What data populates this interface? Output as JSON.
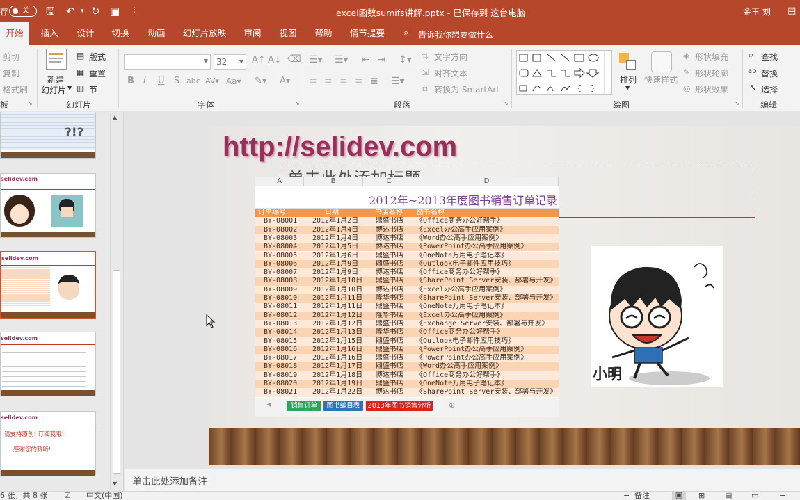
{
  "titlebar": {
    "autosave_label": "存",
    "autosave_state": "关",
    "title": "excel函数sumifs讲解.pptx  -  已保存到 这台电脑",
    "user": "金玉 刘"
  },
  "tabs": [
    "开始",
    "插入",
    "设计",
    "切换",
    "动画",
    "幻灯片放映",
    "审阅",
    "视图",
    "帮助",
    "情节提要"
  ],
  "tell_me": "告诉我你想要做什么",
  "ribbon": {
    "clipboard": {
      "cut": "剪切",
      "copy": "复制",
      "format": "格式刷",
      "label": "板"
    },
    "slides": {
      "new_slide": "新建",
      "new_slide2": "幻灯片",
      "layout": "版式",
      "reset": "重置",
      "section": "节",
      "label": "幻灯片"
    },
    "font": {
      "size": "32",
      "label": "字体"
    },
    "paragraph": {
      "text_direction": "文字方向",
      "align_text": "对齐文本",
      "smartart": "转换为 SmartArt",
      "label": "段落"
    },
    "drawing": {
      "arrange": "排列",
      "quick_styles": "快速样式",
      "shape_fill": "形状填充",
      "shape_outline": "形状轮廓",
      "shape_effects": "形状效果",
      "label": "绘图"
    },
    "editing": {
      "find": "查找",
      "replace": "替换",
      "select": "选择",
      "label": "编辑"
    }
  },
  "thumbnails": [
    {
      "site": ""
    },
    {
      "site": "selidev.com"
    },
    {
      "site": "selidev.com"
    },
    {
      "site": "selidev.com",
      "text": "请支持原创!  订阅我哦!",
      "text2": "感谢您的聆听!"
    }
  ],
  "slide": {
    "url": "http://selidev.com",
    "title_placeholder": "单击此处添加标题",
    "character_label": "小明"
  },
  "sheet": {
    "col_letters": [
      "A",
      "B",
      "C",
      "D"
    ],
    "title": "2012年~2013年度图书销售订单记录",
    "headers": [
      "订单编号",
      "日期",
      "书店名称",
      "图书名称"
    ],
    "rows": [
      [
        "BY-08001",
        "2012年1月2日",
        "鼎盛书店",
        "《Office商务办公好帮手》"
      ],
      [
        "BY-08002",
        "2012年1月4日",
        "博达书店",
        "《Excel办公高手应用案例》"
      ],
      [
        "BY-08003",
        "2012年1月4日",
        "博达书店",
        "《Word办公高手应用案例》"
      ],
      [
        "BY-08004",
        "2012年1月5日",
        "博达书店",
        "《PowerPoint办公高手应用案例》"
      ],
      [
        "BY-08005",
        "2012年1月6日",
        "鼎盛书店",
        "《OneNote万用电子笔记本》"
      ],
      [
        "BY-08006",
        "2012年1月9日",
        "鼎盛书店",
        "《Outlook电子邮件应用技巧》"
      ],
      [
        "BY-08007",
        "2012年1月9日",
        "博达书店",
        "《Office商务办公好帮手》"
      ],
      [
        "BY-08008",
        "2012年1月10日",
        "鼎盛书店",
        "《SharePoint Server安装、部署与开发》"
      ],
      [
        "BY-08009",
        "2012年1月10日",
        "博达书店",
        "《Excel办公高手应用案例》"
      ],
      [
        "BY-08010",
        "2012年1月11日",
        "隆华书店",
        "《SharePoint Server安装、部署与开发》"
      ],
      [
        "BY-08011",
        "2012年1月11日",
        "鼎盛书店",
        "《OneNote万用电子笔记本》"
      ],
      [
        "BY-08012",
        "2012年1月12日",
        "隆华书店",
        "《Excel办公高手应用案例》"
      ],
      [
        "BY-08013",
        "2012年1月12日",
        "鼎盛书店",
        "《Exchange Server安装、部署与开发》"
      ],
      [
        "BY-08014",
        "2012年1月13日",
        "隆华书店",
        "《Office商务办公好帮手》"
      ],
      [
        "BY-08015",
        "2012年1月15日",
        "鼎盛书店",
        "《Outlook电子邮件应用技巧》"
      ],
      [
        "BY-08016",
        "2012年1月16日",
        "鼎盛书店",
        "《PowerPoint办公高手应用案例》"
      ],
      [
        "BY-08017",
        "2012年1月16日",
        "鼎盛书店",
        "《PowerPoint办公高手应用案例》"
      ],
      [
        "BY-08018",
        "2012年1月17日",
        "鼎盛书店",
        "《Word办公高手应用案例》"
      ],
      [
        "BY-08019",
        "2012年1月18日",
        "博达书店",
        "《Office商务办公好帮手》"
      ],
      [
        "BY-08020",
        "2012年1月19日",
        "鼎盛书店",
        "《OneNote万用电子笔记本》"
      ],
      [
        "BY-08021",
        "2012年1月22日",
        "博达书店",
        "《SharePoint Server安装、部署与开发》"
      ]
    ],
    "tabs": [
      "销售订单",
      "图书编目表",
      "2013年图书销售分析"
    ]
  },
  "notes_placeholder": "单击此处添加备注",
  "status": {
    "slide_info": "6 张，共 8 张",
    "language": "中文(中国)",
    "notes": "备注"
  },
  "colors": {
    "accent": "#b7472a",
    "sheet_orange": "#f79646",
    "sheet_title": "#7d3c98"
  }
}
